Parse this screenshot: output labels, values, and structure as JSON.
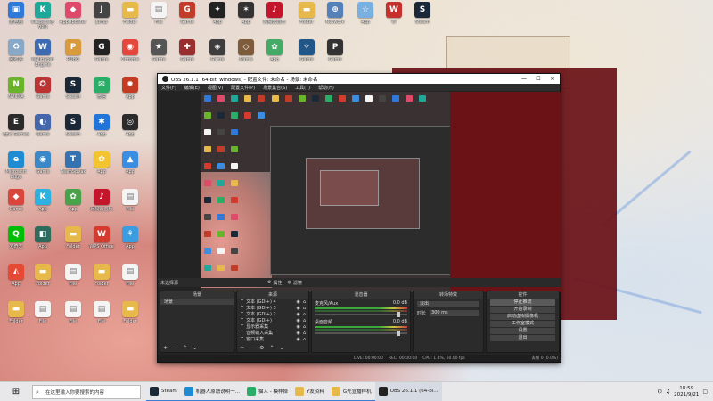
{
  "desktop_icons": [
    {
      "label": "此电脑",
      "color": "#2f79d8",
      "glyph": "▣"
    },
    {
      "label": "Kaspersky VPN",
      "color": "#1fa89a",
      "glyph": "K"
    },
    {
      "label": "AppUpdater",
      "color": "#e04a6a",
      "glyph": "◆"
    },
    {
      "label": "Jump",
      "color": "#444",
      "glyph": "J"
    },
    {
      "label": "Folder",
      "color": "#e7b84a",
      "glyph": "▬"
    },
    {
      "label": "File",
      "color": "#f4f4f4",
      "glyph": "▤"
    },
    {
      "label": "Game",
      "color": "#c23c2a",
      "glyph": "G"
    },
    {
      "label": "App",
      "color": "#222",
      "glyph": "✦"
    },
    {
      "label": "App",
      "color": "#333",
      "glyph": "✶"
    },
    {
      "label": "网易云音乐",
      "color": "#c4162a",
      "glyph": "♪"
    },
    {
      "label": "Folder",
      "color": "#e7b84a",
      "glyph": "▬"
    },
    {
      "label": "Network",
      "color": "#5580b8",
      "glyph": "⊕"
    },
    {
      "label": "App",
      "color": "#7ab0e0",
      "glyph": "☆"
    },
    {
      "label": "W",
      "color": "#c7312d",
      "glyph": "W"
    },
    {
      "label": "Steam",
      "color": "#1b2838",
      "glyph": "S"
    },
    {
      "label": "回收站",
      "color": "#88a8c8",
      "glyph": "♻"
    },
    {
      "label": "Wallpaper Engine",
      "color": "#3d6bb3",
      "glyph": "W"
    },
    {
      "label": "PUBG",
      "color": "#d89a3a",
      "glyph": "P"
    },
    {
      "label": "Game",
      "color": "#222",
      "glyph": "G"
    },
    {
      "label": "Chrome",
      "color": "#e4473b",
      "glyph": "◉"
    },
    {
      "label": "Game",
      "color": "#555",
      "glyph": "★"
    },
    {
      "label": "Game",
      "color": "#992e2e",
      "glyph": "✚"
    },
    {
      "label": "Game",
      "color": "#3d3d3d",
      "glyph": "◈"
    },
    {
      "label": "Game",
      "color": "#7d5b3b",
      "glyph": "◇"
    },
    {
      "label": "App",
      "color": "#44aa66",
      "glyph": "✿"
    },
    {
      "label": "Game",
      "color": "#225588",
      "glyph": "✧"
    },
    {
      "label": "Game",
      "color": "#333",
      "glyph": "P"
    },
    {
      "label": "NVIDIA",
      "color": "#6ab42c",
      "glyph": "N"
    },
    {
      "label": "Game",
      "color": "#b33",
      "glyph": "✪"
    },
    {
      "label": "Steam",
      "color": "#1b2838",
      "glyph": "S"
    },
    {
      "label": "微信",
      "color": "#2aae67",
      "glyph": "✉"
    },
    {
      "label": "App",
      "color": "#c23b22",
      "glyph": "✹"
    },
    {
      "label": "Epic Games",
      "color": "#2a2a2a",
      "glyph": "E"
    },
    {
      "label": "Game",
      "color": "#4466aa",
      "glyph": "◐"
    },
    {
      "label": "Steam",
      "color": "#1b2838",
      "glyph": "S"
    },
    {
      "label": "App",
      "color": "#2275d8",
      "glyph": "✱"
    },
    {
      "label": "App",
      "color": "#2b2b2b",
      "glyph": "◎"
    },
    {
      "label": "Microsoft Edge",
      "color": "#1e8bd2",
      "glyph": "e"
    },
    {
      "label": "Game",
      "color": "#3a88c8",
      "glyph": "◉"
    },
    {
      "label": "TeamSpeak",
      "color": "#3572b0",
      "glyph": "T"
    },
    {
      "label": "App",
      "color": "#f4c430",
      "glyph": "✿"
    },
    {
      "label": "App",
      "color": "#3a8de0",
      "glyph": "▲"
    },
    {
      "label": "Game",
      "color": "#d9463c",
      "glyph": "◆"
    },
    {
      "label": "App",
      "color": "#2db1e0",
      "glyph": "K"
    },
    {
      "label": "App",
      "color": "#49a24a",
      "glyph": "✿"
    },
    {
      "label": "网易云音乐",
      "color": "#c4162a",
      "glyph": "♪"
    },
    {
      "label": "File",
      "color": "#f4f4f4",
      "glyph": "▤"
    },
    {
      "label": "爱奇艺",
      "color": "#00be06",
      "glyph": "Q"
    },
    {
      "label": "App",
      "color": "#2d6b5d",
      "glyph": "◧"
    },
    {
      "label": "Folder",
      "color": "#e7b84a",
      "glyph": "▬"
    },
    {
      "label": "WPS Office",
      "color": "#d43a2e",
      "glyph": "W"
    },
    {
      "label": "App",
      "color": "#3a9de0",
      "glyph": "⚘"
    },
    {
      "label": "App",
      "color": "#e44a34",
      "glyph": "◭"
    },
    {
      "label": "Folder",
      "color": "#e7b84a",
      "glyph": "▬"
    },
    {
      "label": "File",
      "color": "#f4f4f4",
      "glyph": "▤"
    },
    {
      "label": "Folder",
      "color": "#e7b84a",
      "glyph": "▬"
    },
    {
      "label": "File",
      "color": "#f4f4f4",
      "glyph": "▤"
    },
    {
      "label": "Folder",
      "color": "#e7b84a",
      "glyph": "▬"
    },
    {
      "label": "File",
      "color": "#f4f4f4",
      "glyph": "▤"
    },
    {
      "label": "File",
      "color": "#f4f4f4",
      "glyph": "▤"
    },
    {
      "label": "File",
      "color": "#f4f4f4",
      "glyph": "▤"
    },
    {
      "label": "Folder",
      "color": "#e7b84a",
      "glyph": "▬"
    }
  ],
  "obs": {
    "title": "OBS 26.1.1 (64-bit, windows) - 配置文件: 未命名 - 场景: 未命名",
    "menu": [
      "文件(F)",
      "编辑(E)",
      "视图(V)",
      "配置文件(P)",
      "场景集合(S)",
      "工具(T)",
      "帮助(H)"
    ],
    "scene_bar": "未选择源",
    "scene_bar_props": "属性",
    "scene_bar_filters": "滤镜",
    "scenes_title": "场景",
    "scenes": [
      "场景"
    ],
    "sources_title": "来源",
    "sources": [
      "文本 (GDI+) 4",
      "文本 (GDI+) 3",
      "文本 (GDI+) 2",
      "文本 (GDI+)",
      "显示器采集",
      "音频输入采集",
      "窗口采集"
    ],
    "mixer_title": "混音器",
    "mixer": [
      {
        "name": "麦克风/Aux",
        "db": "0.0 dB"
      },
      {
        "name": "桌面音频",
        "db": "0.0 dB"
      }
    ],
    "transitions_title": "转场特效",
    "transition_value": "淡出",
    "duration_label": "时长",
    "duration_value": "300 ms",
    "controls_title": "控件",
    "controls": [
      "停止推流",
      "开始录制",
      "启动虚拟摄像机",
      "工作室模式",
      "设置",
      "退出"
    ],
    "status": [
      "LIVE: 00:00:00",
      "REC: 00:00:00",
      "CPU: 1.4%, 60.00 fps"
    ],
    "status_right": "丢帧 0 (0.0%)"
  },
  "taskbar": {
    "search_placeholder": "在这里输入你要搜索的内容",
    "items": [
      {
        "label": "Steam",
        "color": "#1b2838",
        "state": "open"
      },
      {
        "label": "机器人原籍说明一...",
        "color": "#1e8bd2",
        "state": "open"
      },
      {
        "label": "猫人 - 模样掉",
        "color": "#2aae67",
        "state": "open"
      },
      {
        "label": "Y友资料",
        "color": "#e7b84a",
        "state": "open"
      },
      {
        "label": "G先宣播样机",
        "color": "#e7b84a",
        "state": "open"
      },
      {
        "label": "OBS 26.1.1 (64-bi...",
        "color": "#222",
        "state": "active"
      }
    ],
    "time": "18:59",
    "date": "2021/9/21"
  }
}
